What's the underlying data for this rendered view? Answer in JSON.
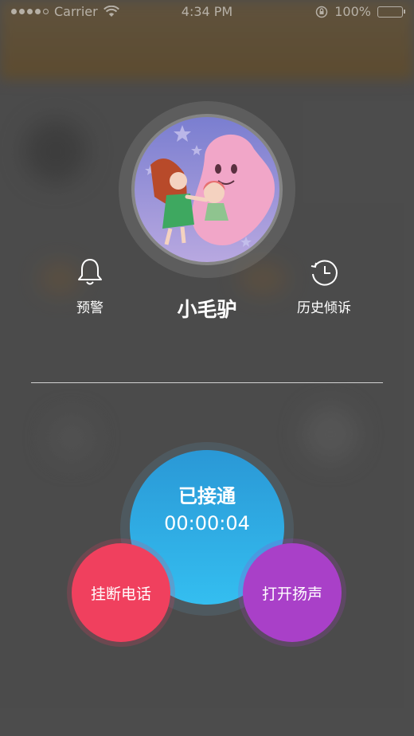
{
  "status_bar": {
    "carrier": "Carrier",
    "time": "4:34 PM",
    "battery": "100%"
  },
  "caller": {
    "name": "小毛驴"
  },
  "actions": {
    "warning_label": "预警",
    "history_label": "历史倾诉"
  },
  "call": {
    "status": "已接通",
    "timer": "00:00:04",
    "hangup_label": "挂断电话",
    "speaker_label": "打开扬声"
  },
  "colors": {
    "call_circle": "#2fb0e8",
    "hangup_button": "#f0405e",
    "speaker_button": "#a940c8"
  }
}
